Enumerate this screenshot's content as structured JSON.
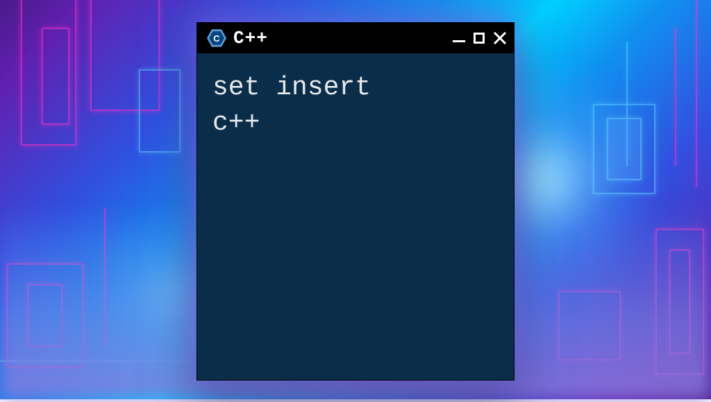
{
  "window": {
    "title": "C++",
    "icon_label": "C",
    "icon_name": "cpp-hexagon-icon"
  },
  "content": {
    "lines": [
      "set insert",
      "c++"
    ]
  },
  "colors": {
    "terminal_bg": "#0a2e4a",
    "titlebar_bg": "#000000",
    "text": "#e8e8e8"
  }
}
